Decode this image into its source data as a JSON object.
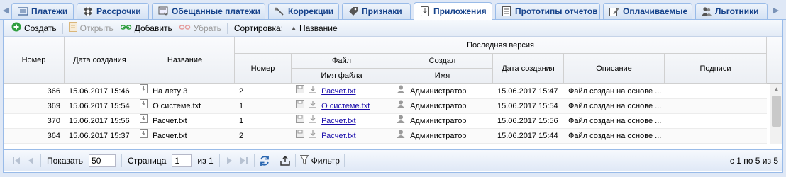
{
  "tabs": [
    {
      "label": "Платежи",
      "icon": "list-icon"
    },
    {
      "label": "Рассрочки",
      "icon": "gear-icon"
    },
    {
      "label": "Обещанные платежи",
      "icon": "promise-icon"
    },
    {
      "label": "Коррекции",
      "icon": "wand-icon"
    },
    {
      "label": "Признаки",
      "icon": "tag-icon"
    },
    {
      "label": "Приложения",
      "icon": "download-icon",
      "active": true
    },
    {
      "label": "Прототипы отчетов",
      "icon": "report-icon"
    },
    {
      "label": "Оплачиваемые",
      "icon": "edit-icon"
    },
    {
      "label": "Льготники",
      "icon": "people-icon"
    }
  ],
  "toolbar": {
    "create": "Создать",
    "open": "Открыть",
    "add": "Добавить",
    "remove": "Убрать",
    "sort_label": "Сортировка:",
    "sort_value": "Название"
  },
  "grid": {
    "headers": {
      "number": "Номер",
      "created": "Дата создания",
      "name": "Название",
      "last_version": "Последняя версия",
      "version_number": "Номер",
      "file": "Файл",
      "file_name": "Имя файла",
      "creator": "Создал",
      "creator_name": "Имя",
      "version_created": "Дата создания",
      "description": "Описание",
      "signatures": "Подписи"
    },
    "rows": [
      {
        "number": "366",
        "created": "15.06.2017 15:46",
        "name": "На лету 3",
        "version": "2",
        "file": "Расчет.txt",
        "creator": "Администратор",
        "version_created": "15.06.2017 15:47",
        "description": "Файл создан на основе ...",
        "signatures": ""
      },
      {
        "number": "369",
        "created": "15.06.2017 15:54",
        "name": "О системе.txt",
        "version": "1",
        "file": "О системе.txt",
        "creator": "Администратор",
        "version_created": "15.06.2017 15:54",
        "description": "Файл создан на основе ...",
        "signatures": ""
      },
      {
        "number": "370",
        "created": "15.06.2017 15:56",
        "name": "Расчет.txt",
        "version": "1",
        "file": "Расчет.txt",
        "creator": "Администратор",
        "version_created": "15.06.2017 15:56",
        "description": "Файл создан на основе ...",
        "signatures": ""
      },
      {
        "number": "364",
        "created": "15.06.2017 15:37",
        "name": "Расчет.txt",
        "version": "2",
        "file": "Расчет.txt",
        "creator": "Администратор",
        "version_created": "15.06.2017 15:44",
        "description": "Файл создан на основе ...",
        "signatures": ""
      }
    ]
  },
  "pager": {
    "show_label": "Показать",
    "page_size": "50",
    "page_label": "Страница",
    "page": "1",
    "of_label": "из 1",
    "filter_label": "Фильтр",
    "info": "с 1 по 5 из 5"
  },
  "colors": {
    "accent": "#15428b",
    "border": "#99bbe8",
    "background": "#dfe8f6",
    "link": "#1a0dab",
    "create_icon": "#2e9e3e"
  }
}
